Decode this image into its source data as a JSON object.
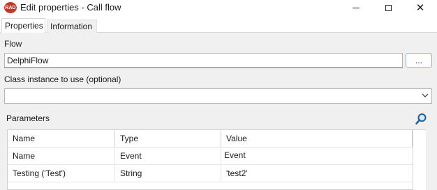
{
  "window": {
    "app_icon_text": "RAD",
    "title": "Edit properties - Call flow",
    "minimize_glyph": "minimize",
    "maximize_glyph": "maximize",
    "close_glyph": "✕"
  },
  "tabs": [
    {
      "label": "Properties",
      "selected": true
    },
    {
      "label": "Information",
      "selected": false
    }
  ],
  "form": {
    "flow_label": "Flow",
    "flow_value": "DelphiFlow",
    "browse_label": "...",
    "class_label": "Class instance to use (optional)",
    "class_value": "",
    "parameters_label": "Parameters"
  },
  "parameters": {
    "columns": [
      "Name",
      "Type",
      "Value"
    ],
    "rows": [
      {
        "name": "Name",
        "type": "Event",
        "value": "Event"
      },
      {
        "name": "Testing ('Test')",
        "type": "String",
        "value": "'test2'"
      }
    ]
  },
  "icons": {
    "search": "search-icon",
    "combo": "chevron-down-icon"
  },
  "colors": {
    "app_icon": "#c0392b",
    "panel_bg": "#f0f0f0",
    "search_icon": "#1f5f96"
  }
}
